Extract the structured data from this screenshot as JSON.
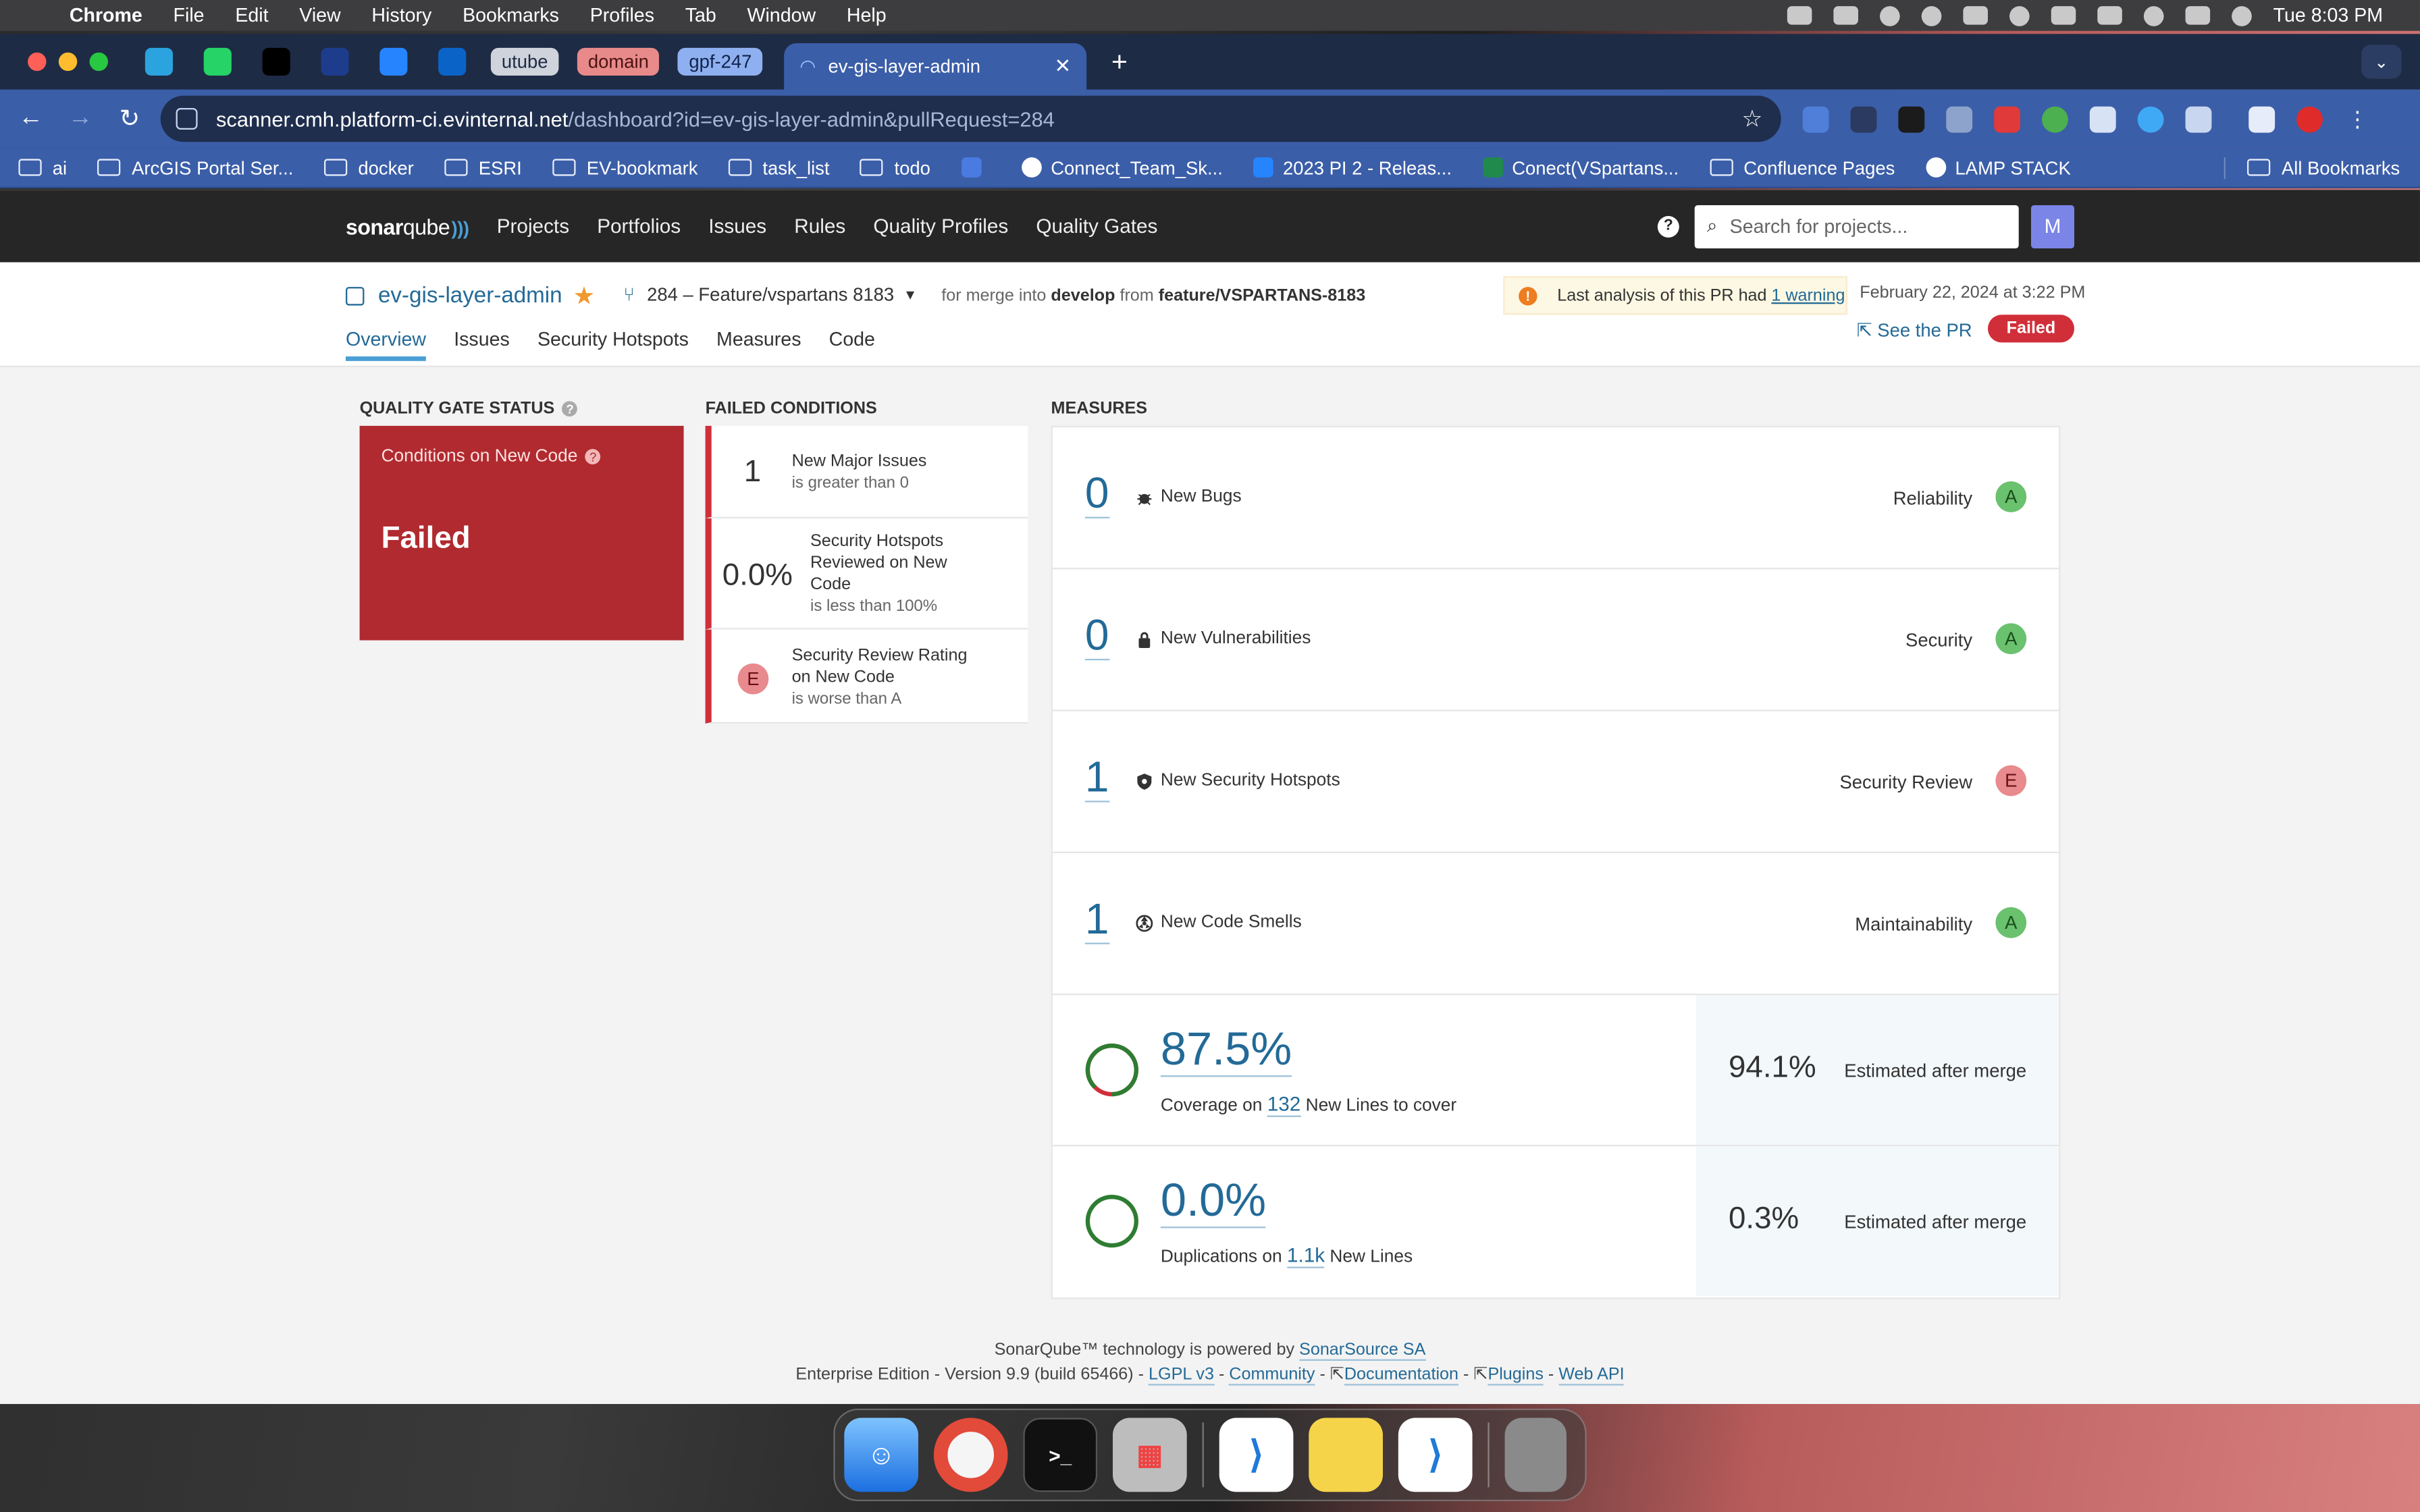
{
  "menubar": {
    "items": [
      "Chrome",
      "File",
      "Edit",
      "View",
      "History",
      "Bookmarks",
      "Profiles",
      "Tab",
      "Window",
      "Help"
    ],
    "clock": "Tue 8:03 PM"
  },
  "tabs": {
    "groups": [
      {
        "label": "utube",
        "bg": "#cfd3db",
        "fg": "#1e2b45"
      },
      {
        "label": "domain",
        "bg": "#e88a8a",
        "fg": "#4a1212"
      },
      {
        "label": "gpf-247",
        "bg": "#8fb0f0",
        "fg": "#10224a"
      }
    ],
    "active_title": "ev-gis-layer-admin"
  },
  "toolbar": {
    "url_host": "scanner.cmh.platform-ci.evinternal.net",
    "url_path": "/dashboard?id=ev-gis-layer-admin&pullRequest=284"
  },
  "bookmarks": [
    "ai",
    "ArcGIS Portal Ser...",
    "docker",
    "ESRI",
    "EV-bookmark",
    "task_list",
    "todo",
    "Connect_Team_Sk...",
    "2023 PI 2 - Releas...",
    "Conect(VSpartans...",
    "Confluence Pages",
    "LAMP STACK"
  ],
  "bookmarks_all": "All Bookmarks",
  "sonar_nav": {
    "logo_bold": "sonar",
    "logo_rest": "qube",
    "links": [
      "Projects",
      "Portfolios",
      "Issues",
      "Rules",
      "Quality Profiles",
      "Quality Gates"
    ],
    "search_placeholder": "Search for projects...",
    "avatar": "M"
  },
  "project": {
    "name": "ev-gis-layer-admin",
    "branch": "284 – Feature/vspartans 8183",
    "merge_prefix": "for merge into",
    "merge_target": "develop",
    "merge_from": "from",
    "merge_source": "feature/VSPARTANS-8183",
    "warning_text": "Last analysis of this PR had",
    "warning_link": "1 warning",
    "date": "February 22, 2024 at 3:22 PM",
    "see_pr": "See the PR",
    "status": "Failed",
    "subtabs": [
      "Overview",
      "Issues",
      "Security Hotspots",
      "Measures",
      "Code"
    ]
  },
  "quality_gate": {
    "title": "QUALITY GATE STATUS",
    "sub": "Conditions on New Code",
    "status": "Failed"
  },
  "failed_conditions": {
    "title": "FAILED CONDITIONS",
    "items": [
      {
        "value": "1",
        "name": "New Major Issues",
        "cmp": "is greater than 0"
      },
      {
        "value": "0.0%",
        "name": "Security Hotspots Reviewed on New Code",
        "cmp": "is less than 100%"
      },
      {
        "value": "E",
        "name": "Security Review Rating on New Code",
        "cmp": "is worse than A"
      }
    ]
  },
  "measures": {
    "title": "MEASURES",
    "rows": [
      {
        "value": "0",
        "label": "New Bugs",
        "category": "Reliability",
        "rating": "A"
      },
      {
        "value": "0",
        "label": "New Vulnerabilities",
        "category": "Security",
        "rating": "A"
      },
      {
        "value": "1",
        "label": "New Security Hotspots",
        "category": "Security Review",
        "rating": "E"
      },
      {
        "value": "1",
        "label": "New Code Smells",
        "category": "Maintainability",
        "rating": "A"
      }
    ],
    "coverage": {
      "value": "87.5%",
      "sub_prefix": "Coverage on",
      "lines": "132",
      "sub_suffix": "New Lines to cover",
      "estimate": "94.1%",
      "estimate_label": "Estimated after merge"
    },
    "duplications": {
      "value": "0.0%",
      "sub_prefix": "Duplications on",
      "lines": "1.1k",
      "sub_suffix": "New Lines",
      "estimate": "0.3%",
      "estimate_label": "Estimated after merge"
    }
  },
  "footer": {
    "line1_prefix": "SonarQube™ technology is powered by",
    "line1_link": "SonarSource SA",
    "edition": "Enterprise Edition - Version 9.9 (build 65466) -",
    "links": [
      "LGPL v3",
      "Community",
      "Documentation",
      "Plugins",
      "Web API"
    ]
  },
  "colors": {
    "accent": "#236a97",
    "fail": "#d02f3a",
    "rating_a": "#6ac16e",
    "rating_e": "#e88a8e"
  }
}
